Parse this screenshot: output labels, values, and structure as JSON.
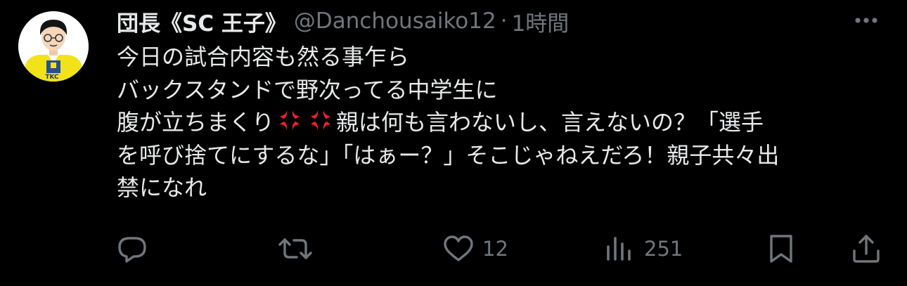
{
  "tweet": {
    "display_name": "団長《SC 王子》",
    "handle": "@Danchousaiko12",
    "separator": "·",
    "time": "1時間",
    "avatar_badge_text": "TKC",
    "body_lines": [
      "今日の試合内容も然る事乍ら",
      "バックスタンドで野次ってる中学生に",
      "腹が立ちまくり",
      "親は何も言わないし、言えないの？「選手",
      "を呼び捨てにするな」「はぁー？」そこじゃねえだろ！親子共々出",
      "禁になれ"
    ],
    "emojis": [
      "anger-symbol",
      "anger-symbol"
    ],
    "emoji_color": "#f4212e"
  },
  "actions": {
    "reply": {
      "icon": "reply-icon",
      "count": ""
    },
    "retweet": {
      "icon": "retweet-icon",
      "count": ""
    },
    "like": {
      "icon": "heart-icon",
      "count": "12"
    },
    "views": {
      "icon": "analytics-icon",
      "count": "251"
    },
    "bookmark": {
      "icon": "bookmark-icon"
    },
    "share": {
      "icon": "share-icon"
    }
  },
  "colors": {
    "background": "#000000",
    "primary_text": "#e7e9ea",
    "secondary_text": "#71767b"
  }
}
